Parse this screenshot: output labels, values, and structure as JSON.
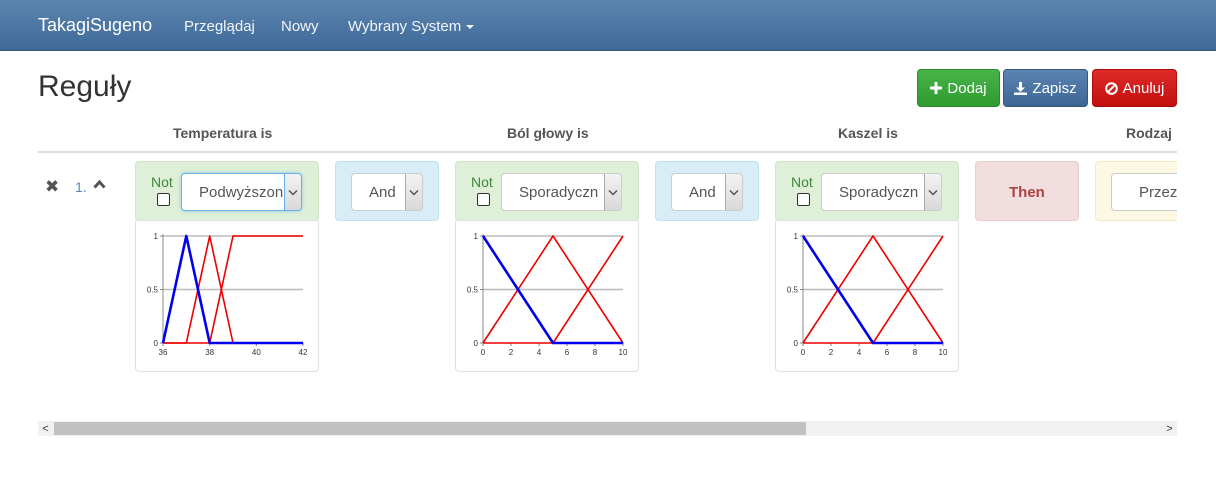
{
  "navbar": {
    "brand": "TakagiSugeno",
    "links": [
      "Przeglądaj",
      "Nowy",
      "Wybrany System"
    ]
  },
  "page": {
    "title": "Reguły",
    "buttons": {
      "add": "Dodaj",
      "save": "Zapisz",
      "cancel": "Anuluj"
    }
  },
  "columns": [
    "Temperatura is",
    "Ból głowy is",
    "Kaszel is",
    "Rodzaj"
  ],
  "rule": {
    "number": "1.",
    "not_label": "Not",
    "operator": "And",
    "then_label": "Then",
    "conclusion_value": "Przezi",
    "premises": [
      {
        "variable": "Temperatura",
        "selected": "Podwyższon",
        "negated": false,
        "chart": {
          "type": "line",
          "xlim": [
            36,
            42
          ],
          "ylim": [
            0,
            1
          ],
          "xticks": [
            "36",
            "38",
            "40",
            "42"
          ],
          "yticks": [
            "0",
            "0.5",
            "1"
          ],
          "grid": true,
          "highlight_color": "#0000ee",
          "other_color": "#ee0000",
          "sets": [
            {
              "highlighted": true,
              "x": [
                36,
                37,
                38,
                42
              ],
              "y": [
                0,
                1,
                0,
                0
              ]
            },
            {
              "highlighted": false,
              "x": [
                36,
                37,
                38,
                39,
                42
              ],
              "y": [
                0,
                0,
                1,
                0,
                0
              ]
            },
            {
              "highlighted": false,
              "x": [
                36,
                38,
                39,
                42
              ],
              "y": [
                0,
                0,
                1,
                1
              ]
            }
          ]
        }
      },
      {
        "variable": "Ból głowy",
        "selected": "Sporadyczn",
        "negated": false,
        "chart": {
          "type": "line",
          "xlim": [
            0,
            10
          ],
          "ylim": [
            0,
            1
          ],
          "xticks": [
            "0",
            "2",
            "4",
            "6",
            "8",
            "10"
          ],
          "yticks": [
            "0",
            "0.5",
            "1"
          ],
          "grid": true,
          "highlight_color": "#0000ee",
          "other_color": "#ee0000",
          "sets": [
            {
              "highlighted": true,
              "x": [
                0,
                5,
                10
              ],
              "y": [
                1,
                0,
                0
              ]
            },
            {
              "highlighted": false,
              "x": [
                0,
                5,
                10
              ],
              "y": [
                0,
                1,
                0
              ]
            },
            {
              "highlighted": false,
              "x": [
                0,
                5,
                10
              ],
              "y": [
                0,
                0,
                1
              ]
            }
          ]
        }
      },
      {
        "variable": "Kaszel",
        "selected": "Sporadyczn",
        "negated": false,
        "chart": {
          "type": "line",
          "xlim": [
            0,
            10
          ],
          "ylim": [
            0,
            1
          ],
          "xticks": [
            "0",
            "2",
            "4",
            "6",
            "8",
            "10"
          ],
          "yticks": [
            "0",
            "0.5",
            "1"
          ],
          "grid": true,
          "highlight_color": "#0000ee",
          "other_color": "#ee0000",
          "sets": [
            {
              "highlighted": true,
              "x": [
                0,
                5,
                10
              ],
              "y": [
                1,
                0,
                0
              ]
            },
            {
              "highlighted": false,
              "x": [
                0,
                5,
                10
              ],
              "y": [
                0,
                1,
                0
              ]
            },
            {
              "highlighted": false,
              "x": [
                0,
                5,
                10
              ],
              "y": [
                0,
                0,
                1
              ]
            }
          ]
        }
      }
    ]
  }
}
